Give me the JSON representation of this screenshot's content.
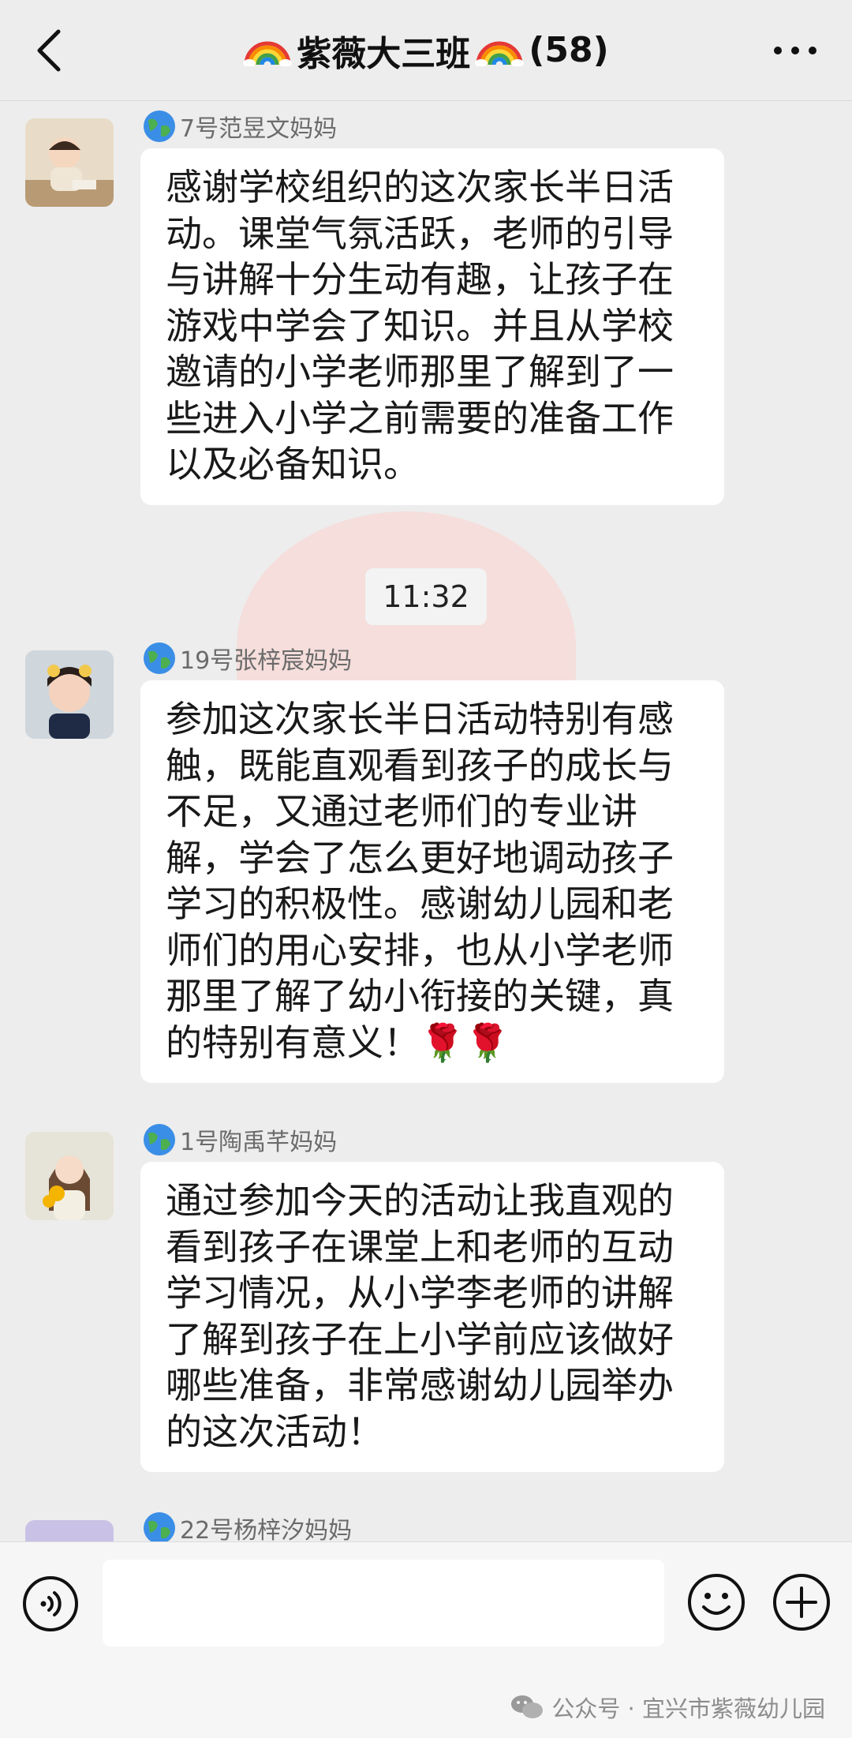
{
  "header": {
    "title": "紫薇大三班",
    "count": "(58)"
  },
  "timestamp": "11:32",
  "messages": [
    {
      "sender": "7号范昱文妈妈",
      "text": "感谢学校组织的这次家长半日活\n动。课堂气氛活跃，老师的引导\n与讲解十分生动有趣，让孩子在\n游戏中学会了知识。并且从学校\n邀请的小学老师那里了解到了一\n些进入小学之前需要的准备工作\n以及必备知识。"
    },
    {
      "sender": "19号张梓宸妈妈",
      "text": "参加这次家长半日活动特别有感\n触，既能直观看到孩子的成长与\n不足，又通过老师们的专业讲\n解，学会了怎么更好地调动孩子\n学习的积极性。感谢幼儿园和老\n师们的用心安排，也从小学老师\n那里了解了幼小衔接的关键，真\n的特别有意义！",
      "emoji": "🌹🌹"
    },
    {
      "sender": "1号陶禹芊妈妈",
      "text": "通过参加今天的活动让我直观的\n看到孩子在课堂上和老师的互动\n学习情况，从小学李老师的讲解\n了解到孩子在上小学前应该做好\n哪些准备，非常感谢幼儿园举办\n的这次活动！"
    },
    {
      "sender": "22号杨梓汐妈妈"
    }
  ],
  "watermark": "公众号 · 宜兴市紫薇幼儿园",
  "icons": {
    "back": "chevron-left-icon",
    "more": "more-dots-icon",
    "voice": "voice-icon",
    "emoji": "smiley-icon",
    "plus": "plus-icon",
    "rainbow": "rainbow-icon",
    "globe": "globe-icon"
  }
}
